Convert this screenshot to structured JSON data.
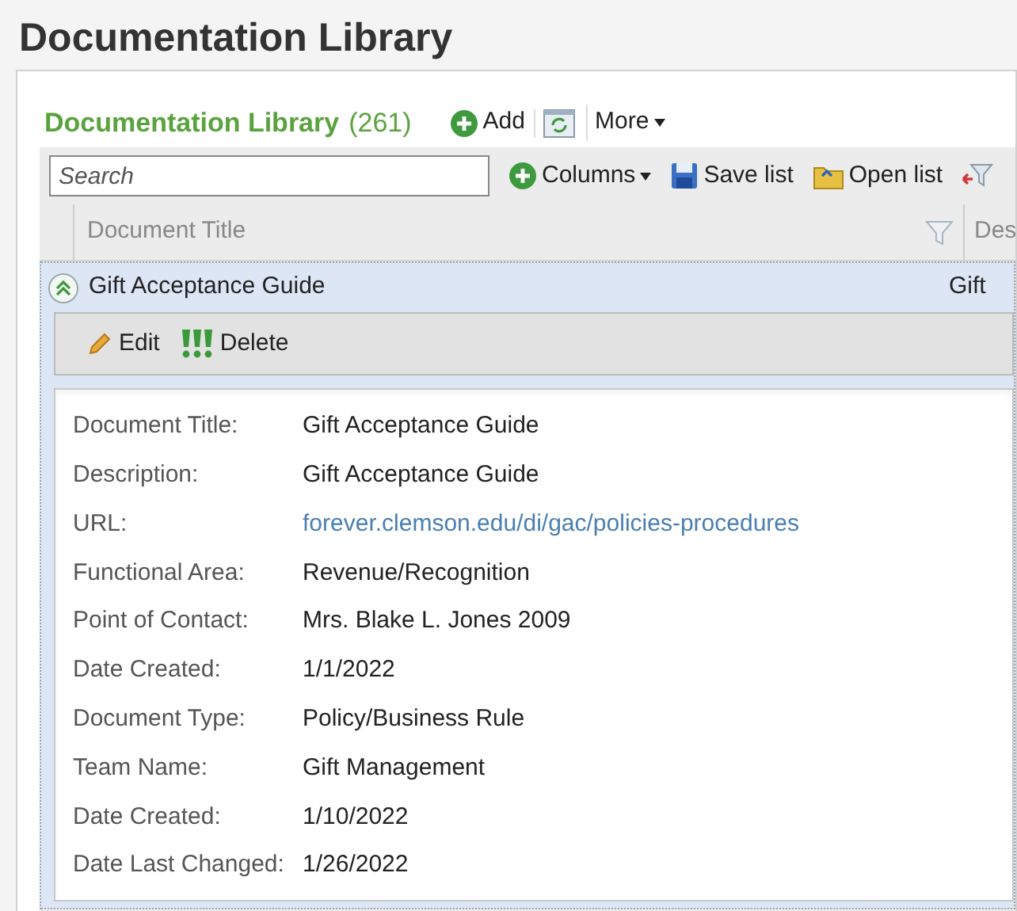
{
  "page_title": "Documentation Library",
  "panel": {
    "title": "Documentation Library",
    "count": "(261)",
    "actions": [
      {
        "label": "Add",
        "kind": "add"
      },
      {
        "kind": "refresh"
      },
      {
        "label": "More",
        "kind": "menu"
      }
    ]
  },
  "toolbar": {
    "search": {
      "placeholder": "Search"
    },
    "buttons": [
      {
        "label": "Columns",
        "kind": "columns"
      },
      {
        "label": "Save list",
        "kind": "save"
      },
      {
        "label": "Open list",
        "kind": "open"
      },
      {
        "kind": "filter"
      }
    ]
  },
  "table": {
    "columns": [
      "Document Title",
      "Des"
    ],
    "rows": [
      {
        "expanded": true,
        "selected": true,
        "cells": [
          "Gift Acceptance Guide",
          "Gift"
        ]
      }
    ]
  },
  "row_actions": [
    {
      "label": "Edit",
      "kind": "edit"
    },
    {
      "label": "Delete",
      "kind": "delete"
    }
  ],
  "details": [
    {
      "label": "Document Title:",
      "value": "Gift Acceptance Guide",
      "kind": "text"
    },
    {
      "label": "Description:",
      "value": "Gift Acceptance Guide",
      "kind": "text"
    },
    {
      "label": "URL:",
      "value": "forever.clemson.edu/di/gac/policies-procedures",
      "kind": "link"
    },
    {
      "label": "Functional Area:",
      "value": "Revenue/Recognition",
      "kind": "text"
    },
    {
      "label": "Point of Contact:",
      "value": "Mrs. Blake L. Jones 2009",
      "kind": "text"
    },
    {
      "label": "Date Created:",
      "value": "1/1/2022",
      "kind": "text"
    },
    {
      "label": "Document Type:",
      "value": "Policy/Business Rule",
      "kind": "text"
    },
    {
      "label": "Team Name:",
      "value": "Gift Management",
      "kind": "text"
    },
    {
      "label": "Date Created:",
      "value": "1/10/2022",
      "kind": "text"
    },
    {
      "label": "Date Last Changed:",
      "value": "1/26/2022",
      "kind": "text"
    }
  ]
}
